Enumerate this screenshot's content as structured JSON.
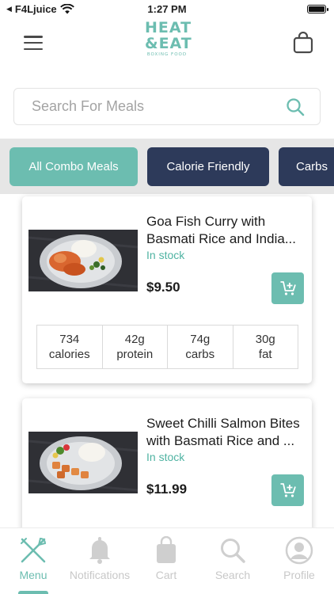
{
  "status_bar": {
    "carrier": "F4Ljuice",
    "time": "1:27 PM"
  },
  "header": {
    "logo": {
      "line1": "HEAT",
      "line2": "&EAT",
      "tagline": "BOXING FOOD"
    }
  },
  "search": {
    "placeholder": "Search For Meals"
  },
  "filters": [
    {
      "label": "All Combo Meals",
      "active": true
    },
    {
      "label": "Calorie Friendly",
      "active": false
    },
    {
      "label": "Carbs",
      "active": false
    }
  ],
  "meals": [
    {
      "title_line1": "Goa Fish Curry with",
      "title_line2": "Basmati Rice and India...",
      "stock": "In stock",
      "price": "$9.50",
      "nutrition": [
        {
          "value": "734",
          "unit": "calories"
        },
        {
          "value": "42g",
          "unit": "protein"
        },
        {
          "value": "74g",
          "unit": "carbs"
        },
        {
          "value": "30g",
          "unit": "fat"
        }
      ]
    },
    {
      "title_line1": "Sweet Chilli Salmon Bites",
      "title_line2": "with Basmati Rice and ...",
      "stock": "In stock",
      "price": "$11.99"
    }
  ],
  "bottom_nav": [
    {
      "label": "Menu",
      "icon": "fork-knife-icon",
      "active": true
    },
    {
      "label": "Notifications",
      "icon": "bell-icon",
      "active": false
    },
    {
      "label": "Cart",
      "icon": "shopping-bag-icon",
      "active": false
    },
    {
      "label": "Search",
      "icon": "search-icon",
      "active": false
    },
    {
      "label": "Profile",
      "icon": "user-icon",
      "active": false
    }
  ],
  "colors": {
    "accent": "#6cbdb0",
    "navy": "#2d3a5a",
    "stock_text": "#4fb3a2",
    "inactive_nav": "#c8c8c8"
  }
}
